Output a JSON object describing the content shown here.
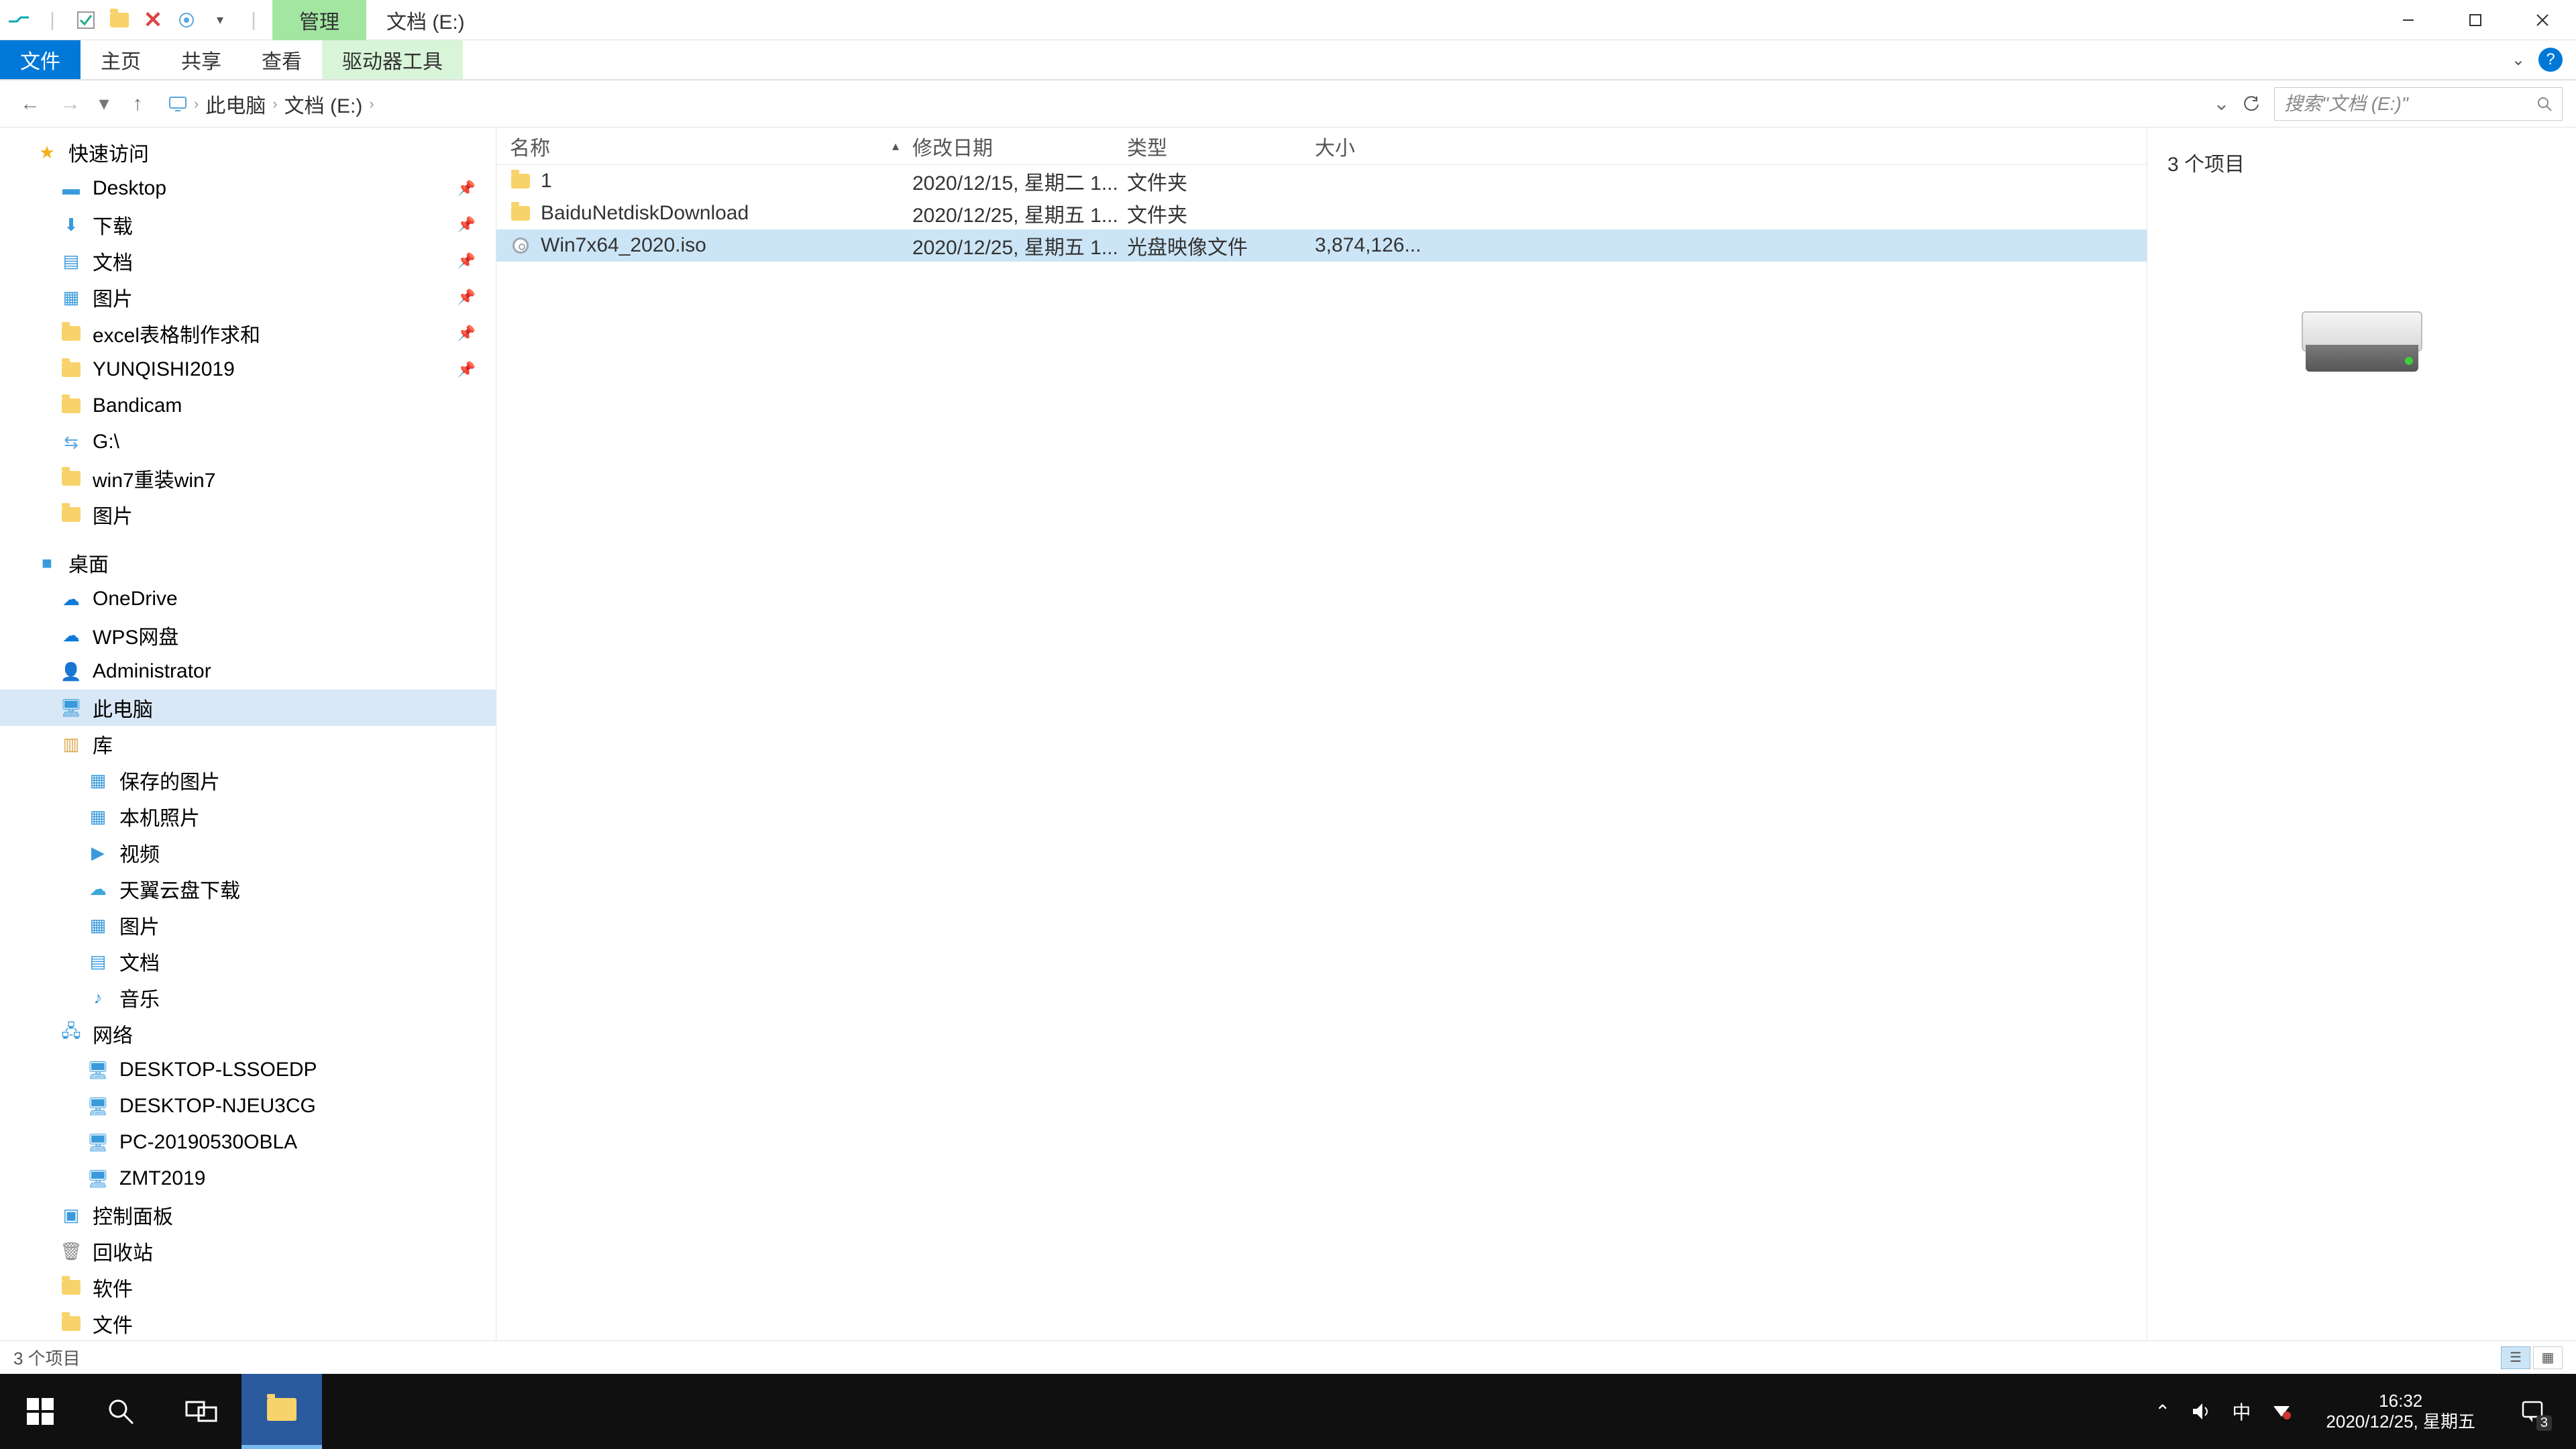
{
  "title_context": {
    "manage": "管理",
    "location": "文档 (E:)"
  },
  "ribbon_tabs": {
    "file": "文件",
    "home": "主页",
    "share": "共享",
    "view": "查看",
    "drive_tools": "驱动器工具"
  },
  "breadcrumb": {
    "pc": "此电脑",
    "drive": "文档 (E:)"
  },
  "search_placeholder": "搜索\"文档 (E:)\"",
  "sidebar": {
    "quick_access": "快速访问",
    "pinned": [
      {
        "label": "Desktop"
      },
      {
        "label": "下载"
      },
      {
        "label": "文档"
      },
      {
        "label": "图片"
      },
      {
        "label": "excel表格制作求和"
      },
      {
        "label": "YUNQISHI2019"
      },
      {
        "label": "Bandicam"
      },
      {
        "label": "G:\\"
      },
      {
        "label": "win7重装win7"
      },
      {
        "label": "图片"
      }
    ],
    "desktop_group": "桌面",
    "desktop_items": [
      {
        "label": "OneDrive"
      },
      {
        "label": "WPS网盘"
      },
      {
        "label": "Administrator"
      },
      {
        "label": "此电脑"
      },
      {
        "label": "库"
      },
      {
        "label": "保存的图片"
      },
      {
        "label": "本机照片"
      },
      {
        "label": "视频"
      },
      {
        "label": "天翼云盘下载"
      },
      {
        "label": "图片"
      },
      {
        "label": "文档"
      },
      {
        "label": "音乐"
      },
      {
        "label": "网络"
      },
      {
        "label": "DESKTOP-LSSOEDP"
      },
      {
        "label": "DESKTOP-NJEU3CG"
      },
      {
        "label": "PC-20190530OBLA"
      },
      {
        "label": "ZMT2019"
      },
      {
        "label": "控制面板"
      },
      {
        "label": "回收站"
      },
      {
        "label": "软件"
      },
      {
        "label": "文件"
      }
    ]
  },
  "columns": {
    "name": "名称",
    "date": "修改日期",
    "type": "类型",
    "size": "大小"
  },
  "rows": [
    {
      "name": "1",
      "date": "2020/12/15, 星期二 1...",
      "type": "文件夹",
      "size": "",
      "kind": "folder"
    },
    {
      "name": "BaiduNetdiskDownload",
      "date": "2020/12/25, 星期五 1...",
      "type": "文件夹",
      "size": "",
      "kind": "folder"
    },
    {
      "name": "Win7x64_2020.iso",
      "date": "2020/12/25, 星期五 1...",
      "type": "光盘映像文件",
      "size": "3,874,126...",
      "kind": "iso"
    }
  ],
  "preview": {
    "count": "3 个项目"
  },
  "statusbar": {
    "text": "3 个项目"
  },
  "taskbar": {
    "time": "16:32",
    "date": "2020/12/25, 星期五",
    "ime": "中",
    "notif_count": "3"
  }
}
